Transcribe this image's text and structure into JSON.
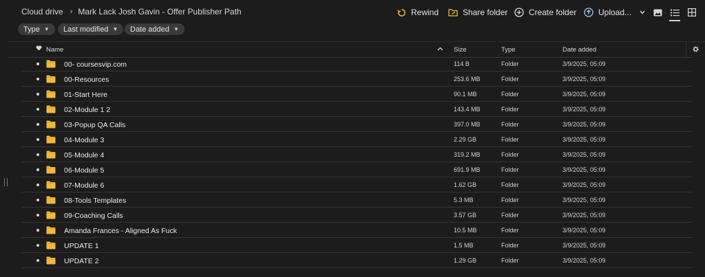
{
  "breadcrumb": {
    "root": "Cloud drive",
    "current": "Mark Lack Josh Gavin - Offer Publisher Path"
  },
  "toolbar": {
    "rewind": "Rewind",
    "share_folder": "Share folder",
    "create_folder": "Create folder",
    "upload": "Upload..."
  },
  "filters": {
    "type": "Type",
    "last_modified": "Last modified",
    "date_added": "Date added"
  },
  "table": {
    "headers": {
      "name": "Name",
      "size": "Size",
      "type": "Type",
      "date_added": "Date added"
    },
    "rows": [
      {
        "name": "00- coursesvip.com",
        "size": "114 B",
        "type": "Folder",
        "date": "3/9/2025, 05:09"
      },
      {
        "name": "00-Resources",
        "size": "253.6 MB",
        "type": "Folder",
        "date": "3/9/2025, 05:09"
      },
      {
        "name": "01-Start Here",
        "size": "90.1 MB",
        "type": "Folder",
        "date": "3/9/2025, 05:09"
      },
      {
        "name": "02-Module 1 2",
        "size": "143.4 MB",
        "type": "Folder",
        "date": "3/9/2025, 05:09"
      },
      {
        "name": "03-Popup QA Calls",
        "size": "397.0 MB",
        "type": "Folder",
        "date": "3/9/2025, 05:09"
      },
      {
        "name": "04-Module 3",
        "size": "2.29 GB",
        "type": "Folder",
        "date": "3/9/2025, 05:09"
      },
      {
        "name": "05-Module 4",
        "size": "319.2 MB",
        "type": "Folder",
        "date": "3/9/2025, 05:09"
      },
      {
        "name": "06-Module 5",
        "size": "691.9 MB",
        "type": "Folder",
        "date": "3/9/2025, 05:09"
      },
      {
        "name": "07-Module 6",
        "size": "1.62 GB",
        "type": "Folder",
        "date": "3/9/2025, 05:09"
      },
      {
        "name": "08-Tools Templates",
        "size": "5.3 MB",
        "type": "Folder",
        "date": "3/9/2025, 05:09"
      },
      {
        "name": "09-Coaching Calls",
        "size": "3.57 GB",
        "type": "Folder",
        "date": "3/9/2025, 05:09"
      },
      {
        "name": "Amanda Frances - Aligned As Fuck",
        "size": "10.5 MB",
        "type": "Folder",
        "date": "3/9/2025, 05:09"
      },
      {
        "name": "UPDATE 1",
        "size": "1.5 MB",
        "type": "Folder",
        "date": "3/9/2025, 05:09"
      },
      {
        "name": "UPDATE 2",
        "size": "1.29 GB",
        "type": "Folder",
        "date": "3/9/2025, 05:09"
      }
    ]
  },
  "colors": {
    "background": "#1c1c1c",
    "folder": "#f2b83b",
    "rewind_accent": "#f2b83b",
    "chip": "#3a3a3a"
  },
  "icons": {
    "rewind": "rewind-icon",
    "share_folder": "share-folder-icon",
    "create_folder": "plus-circle-icon",
    "upload": "upload-icon",
    "thumbnail_view": "image-icon",
    "list_view": "list-icon",
    "grid_view": "grid-icon",
    "settings": "gear-icon",
    "favourite": "heart-icon",
    "sort": "chevron-up-icon",
    "folder": "folder-icon"
  }
}
